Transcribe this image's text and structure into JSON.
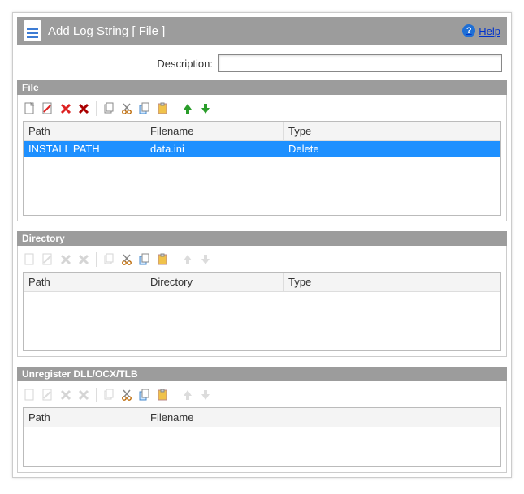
{
  "title": "Add Log String [ File ]",
  "help_label": "Help",
  "description": {
    "label": "Description:",
    "value": ""
  },
  "sections": {
    "file": {
      "header": "File",
      "columns": [
        "Path",
        "Filename",
        "Type"
      ],
      "rows": [
        {
          "path": "INSTALL PATH",
          "filename": "data.ini",
          "type": "Delete",
          "selected": true
        }
      ]
    },
    "directory": {
      "header": "Directory",
      "columns": [
        "Path",
        "Directory",
        "Type"
      ],
      "rows": []
    },
    "unregister": {
      "header": "Unregister DLL/OCX/TLB",
      "columns": [
        "Path",
        "Filename"
      ],
      "rows": []
    }
  },
  "icons": {
    "new": "new-icon",
    "edit": "edit-icon",
    "delete": "delete-icon",
    "delete_all": "delete-all-icon",
    "copy_doc": "copy-doc-icon",
    "cut": "cut-icon",
    "copy": "copy-icon",
    "paste": "paste-icon",
    "up": "arrow-up-icon",
    "down": "arrow-down-icon"
  }
}
